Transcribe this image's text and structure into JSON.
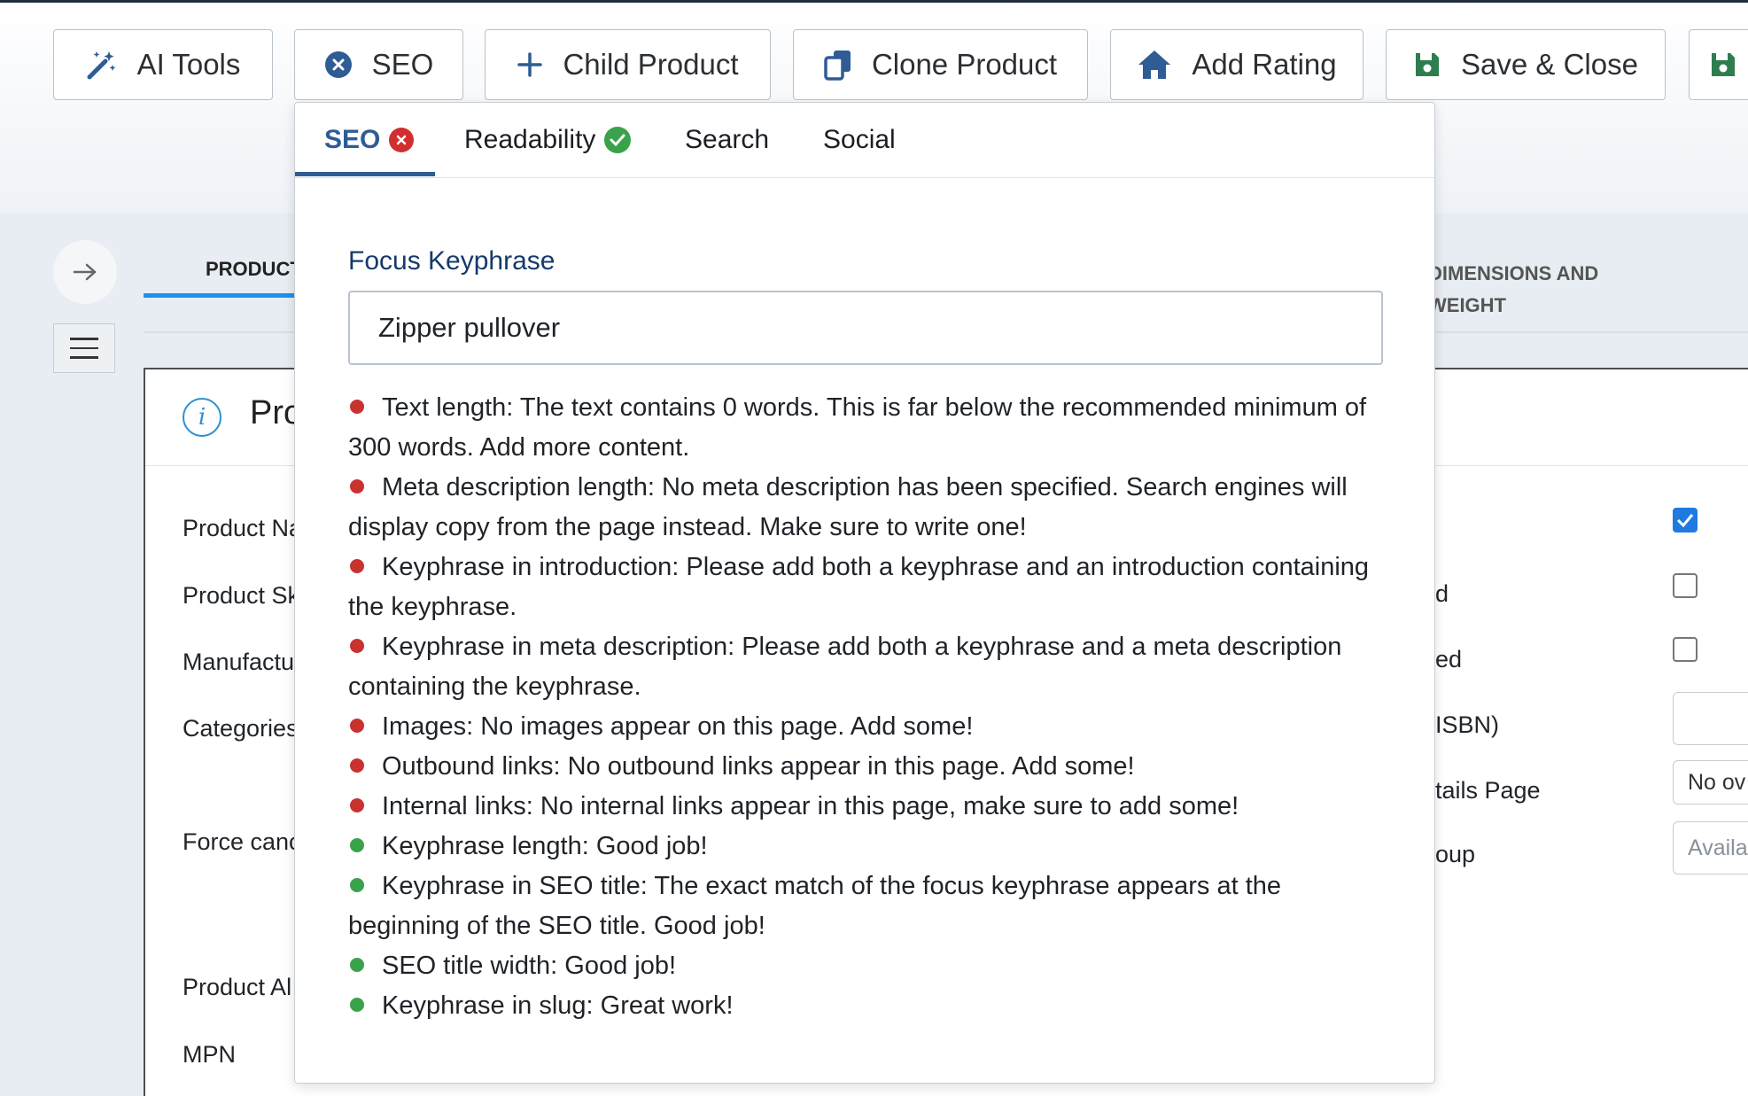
{
  "toolbar": {
    "buttons": [
      {
        "label": "AI Tools",
        "icon": "magic-wand-icon"
      },
      {
        "label": "SEO",
        "icon": "x-circle-icon"
      },
      {
        "label": "Child Product",
        "icon": "plus-icon"
      },
      {
        "label": "Clone Product",
        "icon": "copy-icon"
      },
      {
        "label": "Add Rating",
        "icon": "home-icon"
      },
      {
        "label": "Save & Close",
        "icon": "save-icon"
      }
    ],
    "accent_color": "#2f5c94"
  },
  "product_tabs": {
    "first": "PRODUCT",
    "dims_line1": "DIMENSIONS AND",
    "dims_line2": "WEIGHT"
  },
  "panel": {
    "title": "Pro",
    "labels": [
      "Product Na",
      "Product Sk",
      "Manufactu",
      "Categories",
      "Force canc",
      "Product Al",
      "MPN"
    ],
    "right_labels": [
      "d",
      "ed",
      "ISBN)",
      "tails Page",
      "oup"
    ],
    "select_value": "No ov",
    "availability_placeholder": "Availa"
  },
  "seo_popup": {
    "tabs": [
      {
        "label": "SEO",
        "status": "bad"
      },
      {
        "label": "Readability",
        "status": "good"
      },
      {
        "label": "Search"
      },
      {
        "label": "Social"
      }
    ],
    "focus_keyphrase_label": "Focus Keyphrase",
    "focus_keyphrase_value": "Zipper pullover",
    "results": [
      {
        "status": "bad",
        "text": "Text length: The text contains 0 words. This is far below the recommended minimum of 300 words. Add more content."
      },
      {
        "status": "bad",
        "text": "Meta description length: No meta description has been specified. Search engines will display copy from the page instead. Make sure to write one!"
      },
      {
        "status": "bad",
        "text": "Keyphrase in introduction: Please add both a keyphrase and an introduction containing the keyphrase."
      },
      {
        "status": "bad",
        "text": "Keyphrase in meta description: Please add both a keyphrase and a meta description containing the keyphrase."
      },
      {
        "status": "bad",
        "text": "Images: No images appear on this page. Add some!"
      },
      {
        "status": "bad",
        "text": "Outbound links: No outbound links appear in this page. Add some!"
      },
      {
        "status": "bad",
        "text": "Internal links: No internal links appear in this page, make sure to add some!"
      },
      {
        "status": "good",
        "text": "Keyphrase length: Good job!"
      },
      {
        "status": "good",
        "text": "Keyphrase in SEO title: The exact match of the focus keyphrase appears at the beginning of the SEO title. Good job!"
      },
      {
        "status": "good",
        "text": "SEO title width: Good job!"
      },
      {
        "status": "good",
        "text": "Keyphrase in slug: Great work!"
      }
    ],
    "colors": {
      "bad": "#c8322f",
      "good": "#3aa24a"
    }
  }
}
